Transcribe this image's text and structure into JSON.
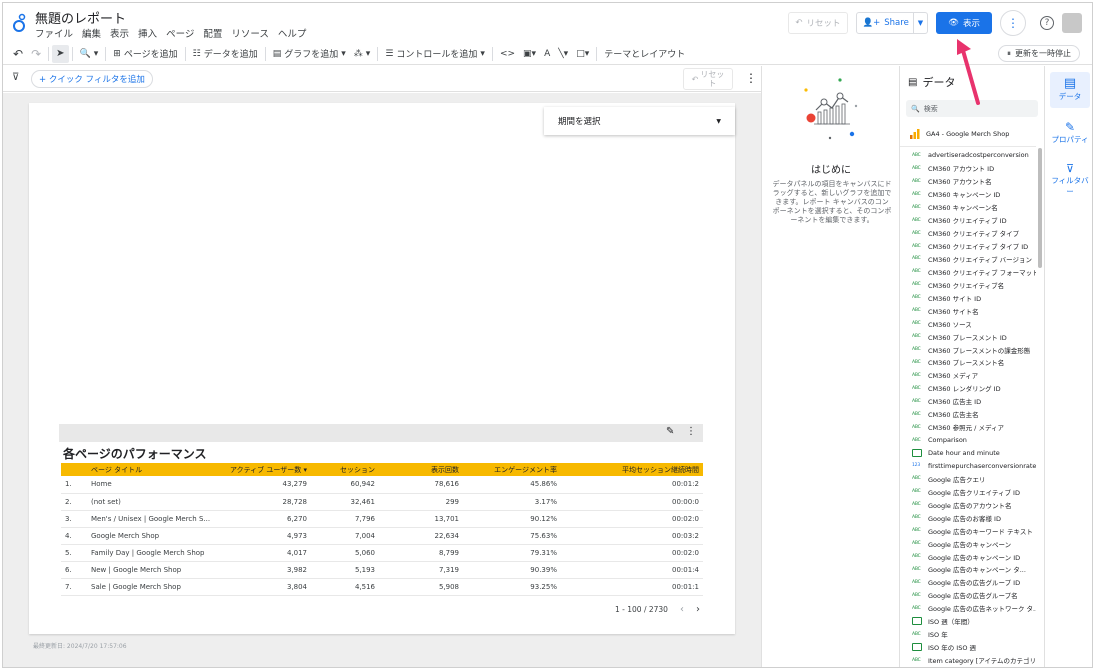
{
  "header": {
    "title": "無題のレポート",
    "menu": [
      "ファイル",
      "編集",
      "表示",
      "挿入",
      "ページ",
      "配置",
      "リソース",
      "ヘルプ"
    ],
    "reset_label": "リセット",
    "share_label": "Share",
    "view_label": "表示"
  },
  "toolbar": {
    "add_page": "ページを追加",
    "add_data": "データを追加",
    "add_chart": "グラフを追加",
    "add_control": "コントロールを追加",
    "theme_layout": "テーマとレイアウト",
    "pause_updates": "更新を一時停止"
  },
  "filterbar": {
    "quick_filter": "+ クイック フィルタを追加",
    "reset": "リセット"
  },
  "canvas": {
    "date_picker": "期間を選択",
    "footer_note": "最終更新日: 2024/7/20 17:57:06"
  },
  "table": {
    "title": "各ページのパフォーマンス",
    "headers": [
      "ページ タイトル",
      "アクティブ ユーザー数 ▾",
      "セッション",
      "表示回数",
      "エンゲージメント率",
      "平均セッション継続時間"
    ],
    "rows": [
      [
        "1.",
        "Home",
        "43,279",
        "60,942",
        "78,616",
        "45.86%",
        "00:01:2"
      ],
      [
        "2.",
        "(not set)",
        "28,728",
        "32,461",
        "299",
        "3.17%",
        "00:00:0"
      ],
      [
        "3.",
        "Men's / Unisex | Google Merch S...",
        "6,270",
        "7,796",
        "13,701",
        "90.12%",
        "00:02:0"
      ],
      [
        "4.",
        "Google Merch Shop",
        "4,973",
        "7,004",
        "22,634",
        "75.63%",
        "00:03:2"
      ],
      [
        "5.",
        "Family Day | Google Merch Shop",
        "4,017",
        "5,060",
        "8,799",
        "79.31%",
        "00:02:0"
      ],
      [
        "6.",
        "New | Google Merch Shop",
        "3,982",
        "5,193",
        "7,319",
        "90.39%",
        "00:01:4"
      ],
      [
        "7.",
        "Sale | Google Merch Shop",
        "3,804",
        "4,516",
        "5,908",
        "93.25%",
        "00:01:1"
      ]
    ],
    "pagination": "1 - 100 / 2730"
  },
  "intro": {
    "title": "はじめに",
    "text": "データパネルの項目をキャンバスにドラッグすると、新しいグラフを追加できます。レポート キャンバスのコンポーネントを選択すると、そのコンポーネントを編集できます。"
  },
  "data_panel": {
    "header": "データ",
    "search_placeholder": "検索",
    "source": "GA4 - Google Merch Shop",
    "fields": [
      {
        "type": "ABC",
        "name": "advertiseradcostperconversion"
      },
      {
        "type": "ABC",
        "name": "CM360 アカウント ID"
      },
      {
        "type": "ABC",
        "name": "CM360 アカウント名"
      },
      {
        "type": "ABC",
        "name": "CM360 キャンペーン ID"
      },
      {
        "type": "ABC",
        "name": "CM360 キャンペーン名"
      },
      {
        "type": "ABC",
        "name": "CM360 クリエイティブ ID"
      },
      {
        "type": "ABC",
        "name": "CM360 クリエイティブ タイプ"
      },
      {
        "type": "ABC",
        "name": "CM360 クリエイティブ タイプ ID"
      },
      {
        "type": "ABC",
        "name": "CM360 クリエイティブ バージョン"
      },
      {
        "type": "ABC",
        "name": "CM360 クリエイティブ フォーマット"
      },
      {
        "type": "ABC",
        "name": "CM360 クリエイティブ名"
      },
      {
        "type": "ABC",
        "name": "CM360 サイト ID"
      },
      {
        "type": "ABC",
        "name": "CM360 サイト名"
      },
      {
        "type": "ABC",
        "name": "CM360 ソース"
      },
      {
        "type": "ABC",
        "name": "CM360 プレースメント ID"
      },
      {
        "type": "ABC",
        "name": "CM360 プレースメントの課金形態"
      },
      {
        "type": "ABC",
        "name": "CM360 プレースメント名"
      },
      {
        "type": "ABC",
        "name": "CM360 メディア"
      },
      {
        "type": "ABC",
        "name": "CM360 レンダリング ID"
      },
      {
        "type": "ABC",
        "name": "CM360 広告主 ID"
      },
      {
        "type": "ABC",
        "name": "CM360 広告主名"
      },
      {
        "type": "ABC",
        "name": "CM360 参照元 / メディア"
      },
      {
        "type": "ABC",
        "name": "Comparison"
      },
      {
        "type": "CAL",
        "name": "Date hour and minute"
      },
      {
        "type": "123",
        "name": "firsttimepurchaserconversionrate"
      },
      {
        "type": "ABC",
        "name": "Google 広告クエリ"
      },
      {
        "type": "ABC",
        "name": "Google 広告クリエイティブ ID"
      },
      {
        "type": "ABC",
        "name": "Google 広告のアカウント名"
      },
      {
        "type": "ABC",
        "name": "Google 広告のお客様 ID"
      },
      {
        "type": "ABC",
        "name": "Google 広告のキーワード テキスト"
      },
      {
        "type": "ABC",
        "name": "Google 広告のキャンペーン"
      },
      {
        "type": "ABC",
        "name": "Google 広告のキャンペーン ID"
      },
      {
        "type": "ABC",
        "name": "Google 広告のキャンペーン タ..."
      },
      {
        "type": "ABC",
        "name": "Google 広告の広告グループ ID"
      },
      {
        "type": "ABC",
        "name": "Google 広告の広告グループ名"
      },
      {
        "type": "ABC",
        "name": "Google 広告の広告ネットワーク タ..."
      },
      {
        "type": "CAL",
        "name": "ISO 週（年間）"
      },
      {
        "type": "ABC",
        "name": "ISO 年"
      },
      {
        "type": "CAL",
        "name": "ISO 年の ISO 週"
      },
      {
        "type": "ABC",
        "name": "Item category [アイテムのカテゴリ]"
      }
    ]
  },
  "rail": {
    "data": "データ",
    "properties": "プロパティ",
    "filter": "フィルタバー"
  },
  "colors": {
    "accent": "#1a73e8",
    "table_header": "#f7b900",
    "arrow": "#e8336d"
  }
}
